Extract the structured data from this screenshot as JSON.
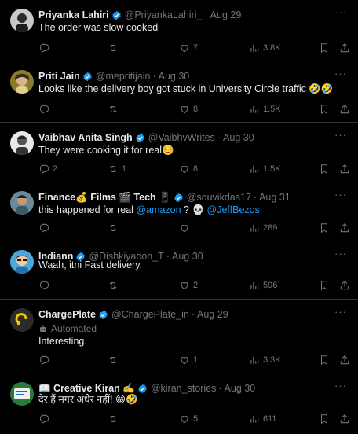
{
  "tweets": [
    {
      "name": "Priyanka Lahiri",
      "handle": "@PriyankaLahiri_",
      "time": "Aug 29",
      "text": "The order was slow cooked",
      "replies": "",
      "reposts": "",
      "likes": "7",
      "views": "3.8K"
    },
    {
      "name": "Priti Jain",
      "handle": "@mepritijain",
      "time": "Aug 30",
      "text": "Looks like the delivery boy got stuck in University Circle traffic 🤣🤣",
      "replies": "",
      "reposts": "",
      "likes": "8",
      "views": "1.5K"
    },
    {
      "name": "Vaibhav Anita Singh",
      "handle": "@VaibhvWrites",
      "time": "Aug 30",
      "text": "They were cooking it for real☺️",
      "replies": "2",
      "reposts": "1",
      "likes": "8",
      "views": "1.5K"
    },
    {
      "name": "Finance💰 Films 🎬 Tech 📱",
      "handle": "@souvikdas17",
      "time": "Aug 31",
      "text_pre": "this happened for real ",
      "mention1": "@amazon",
      "text_mid": " ? 💀 ",
      "mention2": "@JeffBezos",
      "replies": "",
      "reposts": "",
      "likes": "",
      "views": "289"
    },
    {
      "name": "Indiann",
      "handle": "@Dishkiyaoon_T",
      "time": "Aug 30",
      "text": "Waah, itni Fast delivery.",
      "replies": "",
      "reposts": "",
      "likes": "2",
      "views": "596"
    },
    {
      "name": "ChargePlate",
      "handle": "@ChargePlate_in",
      "time": "Aug 29",
      "automated": "Automated",
      "text": "Interesting.",
      "replies": "",
      "reposts": "",
      "likes": "1",
      "views": "3.3K"
    },
    {
      "name": "📖 Creative Kiran ✍️",
      "handle": "@kiran_stories",
      "time": "Aug 30",
      "text": "देर हैं मगर अंधेर नहीं! 😁🤣",
      "replies": "",
      "reposts": "",
      "likes": "5",
      "views": "611"
    }
  ],
  "icons": {
    "reply": "reply-icon",
    "repost": "repost-icon",
    "like": "heart-icon",
    "views": "views-icon",
    "bookmark": "bookmark-icon",
    "share": "share-icon",
    "more": "more-icon",
    "verified": "verified-badge-icon"
  },
  "colors": {
    "accent": "#1d9bf0",
    "muted": "#71767b",
    "text": "#e7e9ea",
    "divider": "#2f3336"
  }
}
